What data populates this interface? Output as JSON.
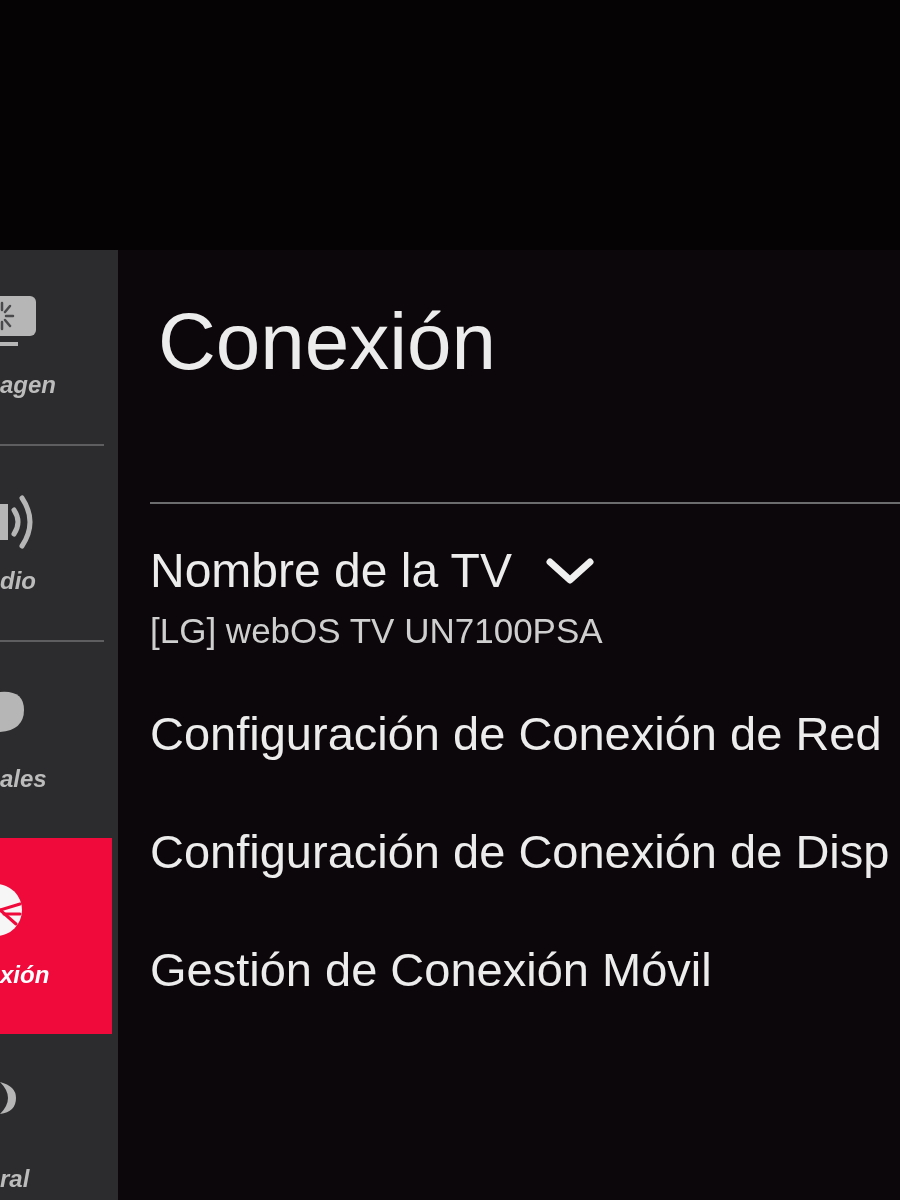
{
  "sidebar": {
    "items": [
      {
        "label": "agen",
        "selected": false
      },
      {
        "label": "dio",
        "selected": false
      },
      {
        "label": "ales",
        "selected": false
      },
      {
        "label": "xión",
        "selected": true
      },
      {
        "label": "ral",
        "selected": false
      }
    ]
  },
  "page": {
    "title": "Conexión"
  },
  "settings": [
    {
      "kind": "dropdown",
      "label": "Nombre de la TV",
      "value": "[LG] webOS TV UN7100PSA"
    },
    {
      "kind": "link",
      "label": "Configuración de Conexión de Red"
    },
    {
      "kind": "link",
      "label": "Configuración de Conexión de Disp"
    },
    {
      "kind": "link",
      "label": "Gestión de Conexión Móvil"
    }
  ]
}
